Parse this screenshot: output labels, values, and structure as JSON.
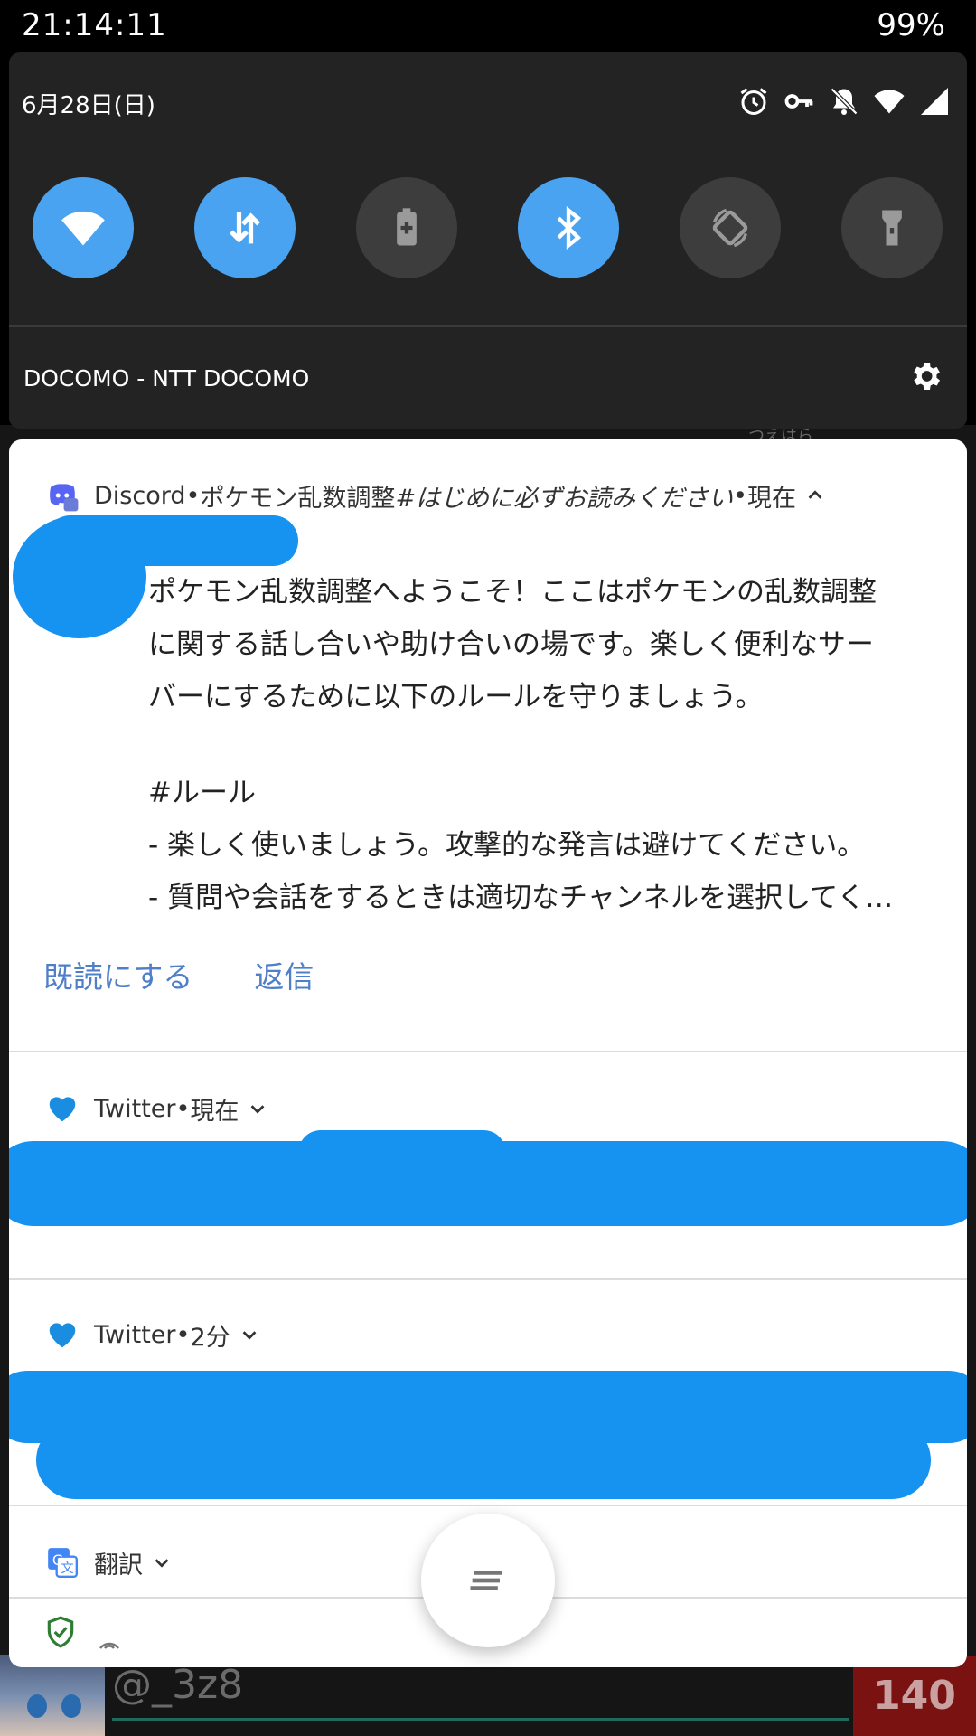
{
  "status_bar": {
    "time": "21:14:11",
    "battery": "99%"
  },
  "quick_settings": {
    "date": "6月28日(日)",
    "status_icons": [
      "alarm-icon",
      "vpn-key-icon",
      "notifications-off-icon",
      "wifi-icon",
      "signal-icon"
    ],
    "tiles": [
      {
        "name": "wifi-tile",
        "icon": "wifi-icon",
        "active": true
      },
      {
        "name": "mobile-data-tile",
        "icon": "data-transfer-icon",
        "active": true
      },
      {
        "name": "battery-saver-tile",
        "icon": "battery-saver-icon",
        "active": false
      },
      {
        "name": "bluetooth-tile",
        "icon": "bluetooth-icon",
        "active": true
      },
      {
        "name": "auto-rotate-tile",
        "icon": "auto-rotate-icon",
        "active": false
      },
      {
        "name": "flashlight-tile",
        "icon": "flashlight-icon",
        "active": false
      }
    ],
    "carrier": "DOCOMO - NTT DOCOMO"
  },
  "notifications": {
    "discord": {
      "app": "Discord",
      "sep1": " • ",
      "channel": "ポケモン乱数調整 ",
      "topic": "#はじめに必ずお読みください",
      "sep2": " • ",
      "time": "現在",
      "body_lines": [
        "ポケモン乱数調整へようこそ！ここはポケモンの乱数調整",
        "に関する話し合いや助け合いの場です。楽しく便利なサー",
        "バーにするために以下のルールを守りましょう。",
        "",
        "#ルール",
        "- 楽しく使いましょう。攻撃的な発言は避けてください。",
        "- 質問や会話をするときは適切なチャンネルを選択してく…"
      ],
      "actions": {
        "mark_read": "既読にする",
        "reply": "返信"
      }
    },
    "twitter1": {
      "app": "Twitter",
      "sep": " • ",
      "time": "現在"
    },
    "twitter2": {
      "app": "Twitter",
      "sep": " • ",
      "time": "2分"
    },
    "translate": {
      "app": "翻訳"
    }
  },
  "background_app": {
    "peek_text": "つえはら",
    "handle": "@_3z8",
    "count": "140"
  },
  "colors": {
    "accent": "#4aa3f0",
    "panel_bg": "#ffffff",
    "action_link": "#4f7fc8",
    "redaction": "#1692f0"
  }
}
